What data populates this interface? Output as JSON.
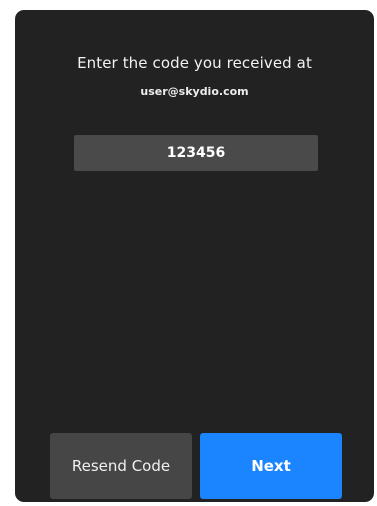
{
  "prompt": {
    "title": "Enter the code you received at",
    "email": "user@skydio.com"
  },
  "code_field": {
    "value": "123456"
  },
  "actions": {
    "resend_label": "Resend Code",
    "next_label": "Next"
  },
  "colors": {
    "panel_background": "#222222",
    "input_background": "#4a4a4a",
    "secondary_button": "#464646",
    "primary_button": "#1a85ff"
  }
}
